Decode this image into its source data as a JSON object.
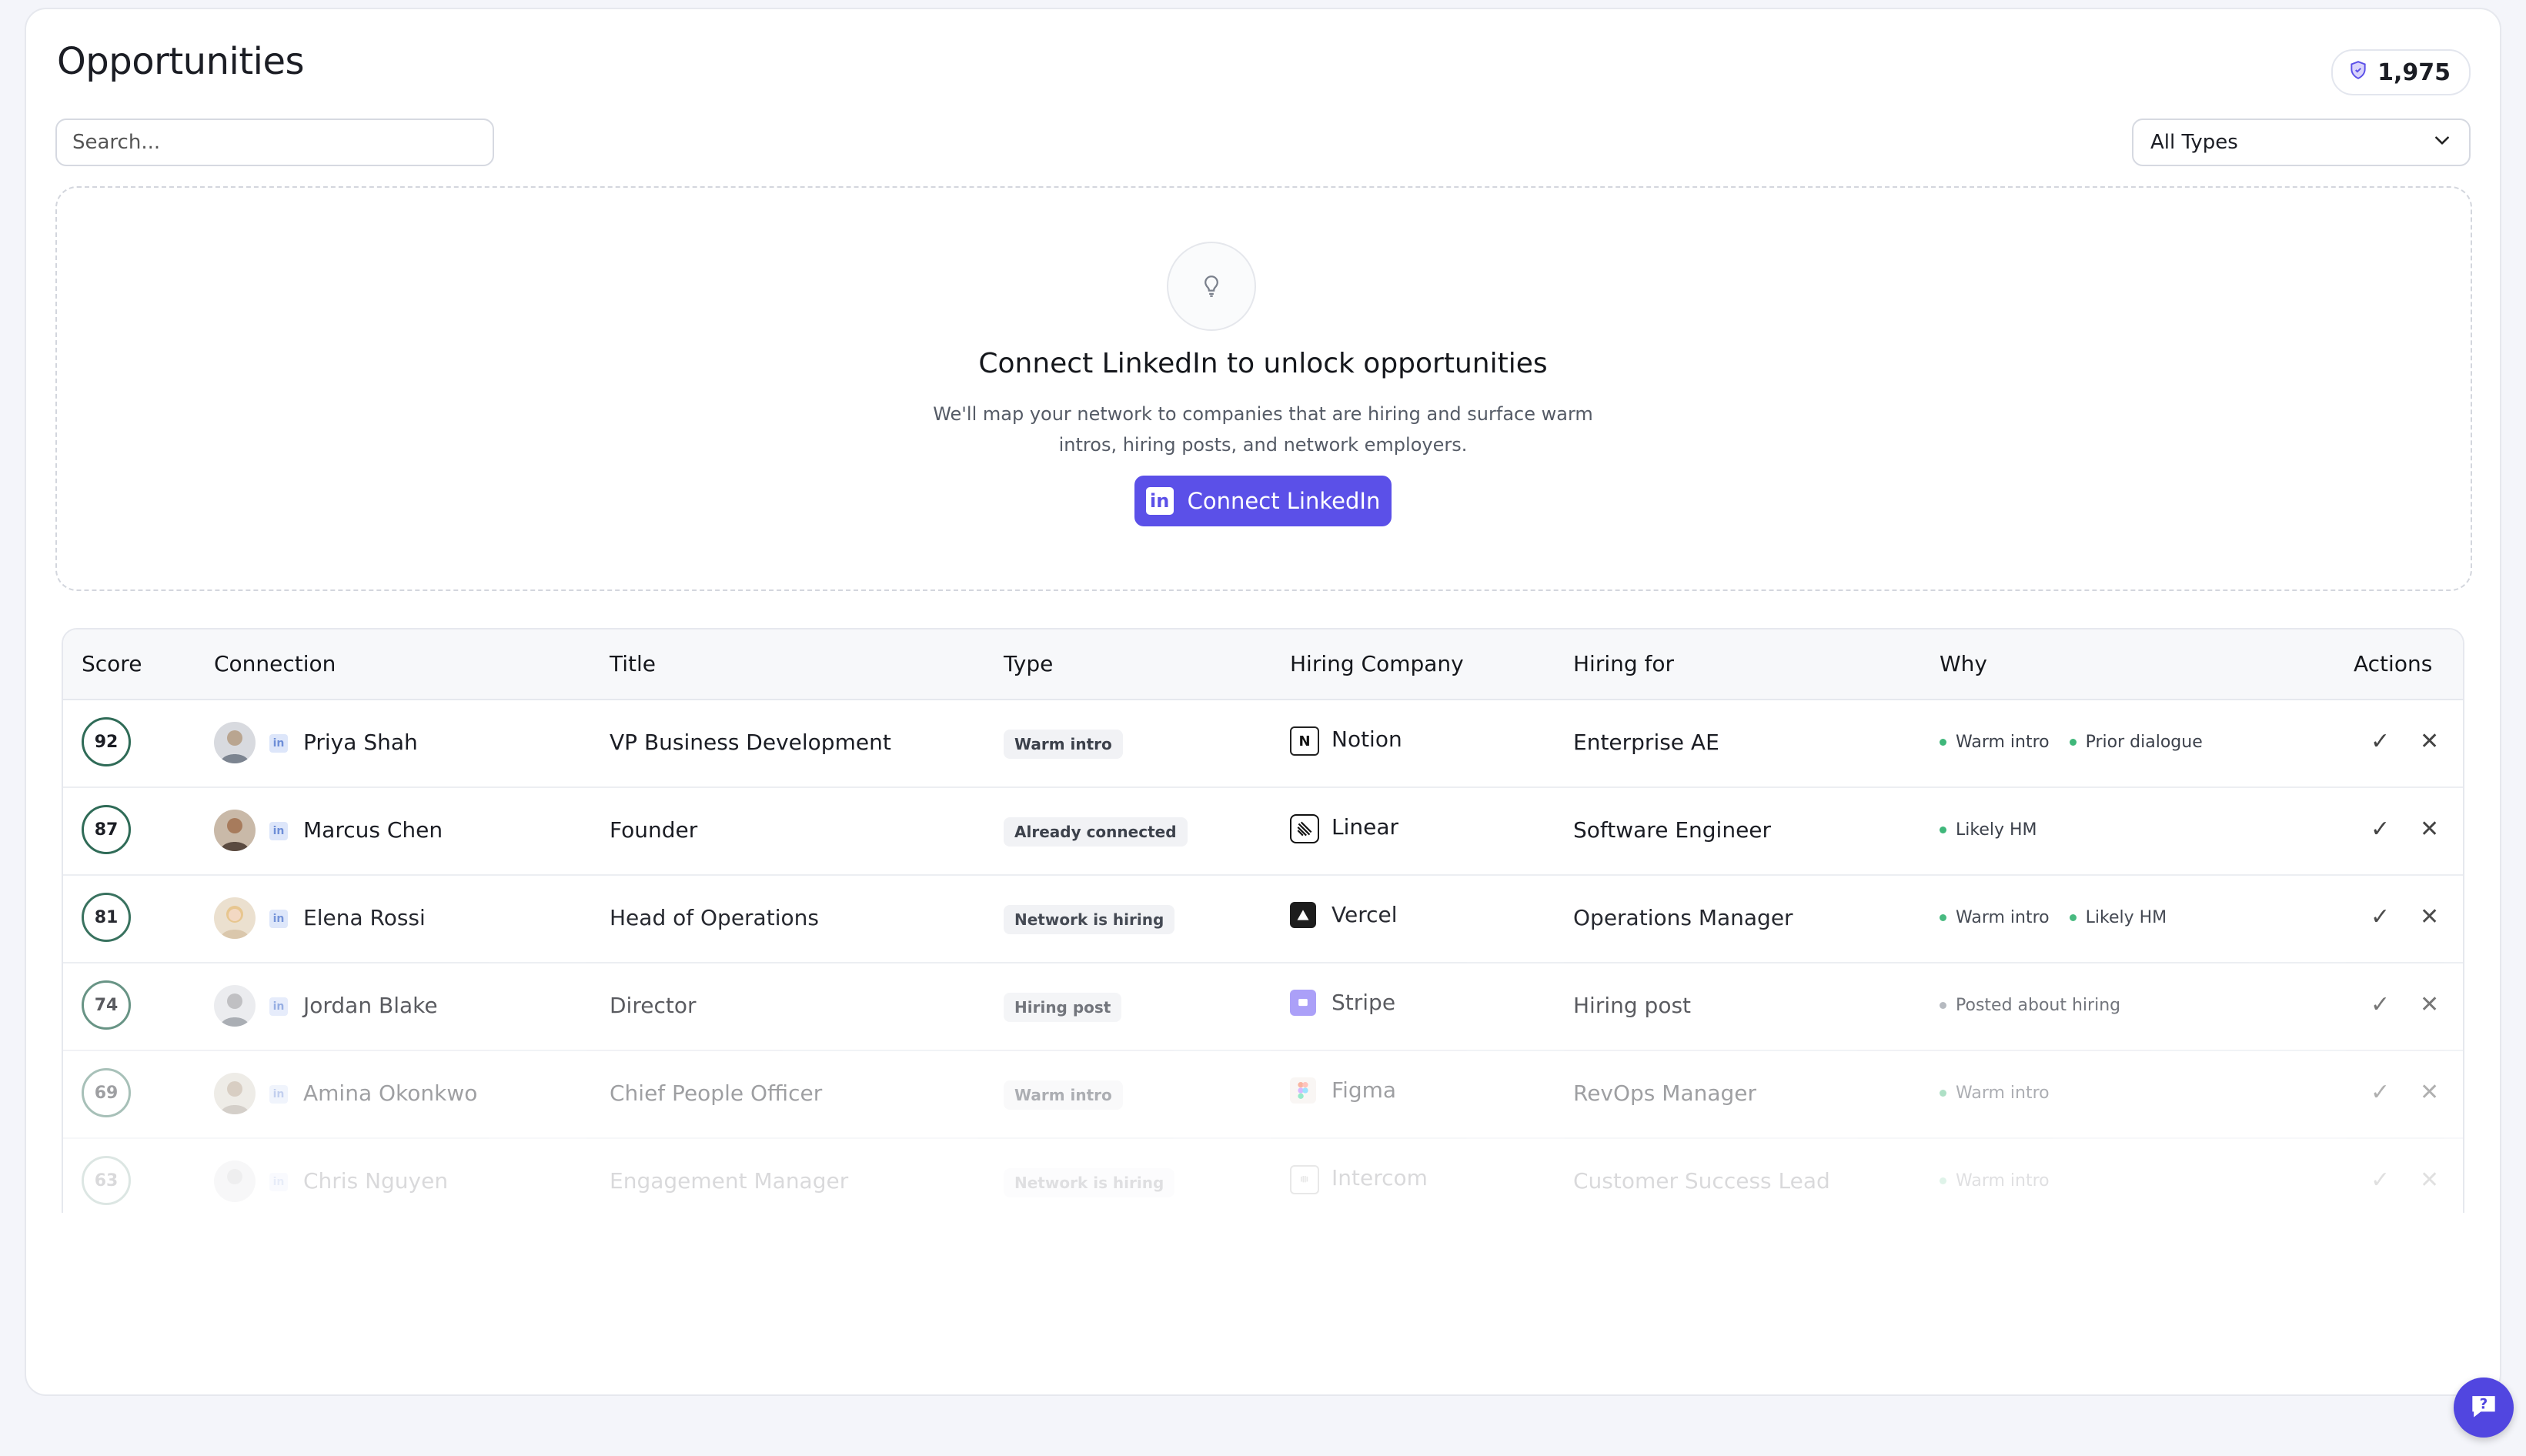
{
  "header": {
    "title": "Opportunities",
    "credits": "1,975"
  },
  "search": {
    "placeholder": "Search..."
  },
  "filter": {
    "selected": "All Types"
  },
  "cta": {
    "title": "Connect LinkedIn to unlock opportunities",
    "description": "We'll map your network to companies that are hiring and surface warm intros, hiring posts, and network employers.",
    "button": "Connect LinkedIn"
  },
  "table": {
    "headers": [
      "Score",
      "Connection",
      "Title",
      "Type",
      "Hiring Company",
      "Hiring for",
      "Why",
      "Actions"
    ],
    "rows": [
      {
        "score": "92",
        "name": "Priya Shah",
        "title": "VP Business Development",
        "type": "Warm intro",
        "company": "Notion",
        "hiring_for": "Enterprise AE",
        "why": [
          "Warm intro",
          "Prior dialogue"
        ]
      },
      {
        "score": "87",
        "name": "Marcus Chen",
        "title": "Founder",
        "type": "Already connected",
        "company": "Linear",
        "hiring_for": "Software Engineer",
        "why": [
          "Likely HM"
        ]
      },
      {
        "score": "81",
        "name": "Elena Rossi",
        "title": "Head of Operations",
        "type": "Network is hiring",
        "company": "Vercel",
        "hiring_for": "Operations Manager",
        "why": [
          "Warm intro",
          "Likely HM"
        ]
      },
      {
        "score": "74",
        "name": "Jordan Blake",
        "title": "Director",
        "type": "Hiring post",
        "company": "Stripe",
        "hiring_for": "Hiring post",
        "why": [
          "Posted about hiring"
        ]
      },
      {
        "score": "69",
        "name": "Amina Okonkwo",
        "title": "Chief People Officer",
        "type": "Warm intro",
        "company": "Figma",
        "hiring_for": "RevOps Manager",
        "why": [
          "Warm intro"
        ]
      },
      {
        "score": "63",
        "name": "Chris Nguyen",
        "title": "Engagement Manager",
        "type": "Network is hiring",
        "company": "Intercom",
        "hiring_for": "Customer Success Lead",
        "why": [
          "Warm intro"
        ]
      }
    ]
  },
  "colors": {
    "accent": "#5b50e8",
    "score_ring": "#2f6b57",
    "why_dot": "#3fb77a"
  }
}
